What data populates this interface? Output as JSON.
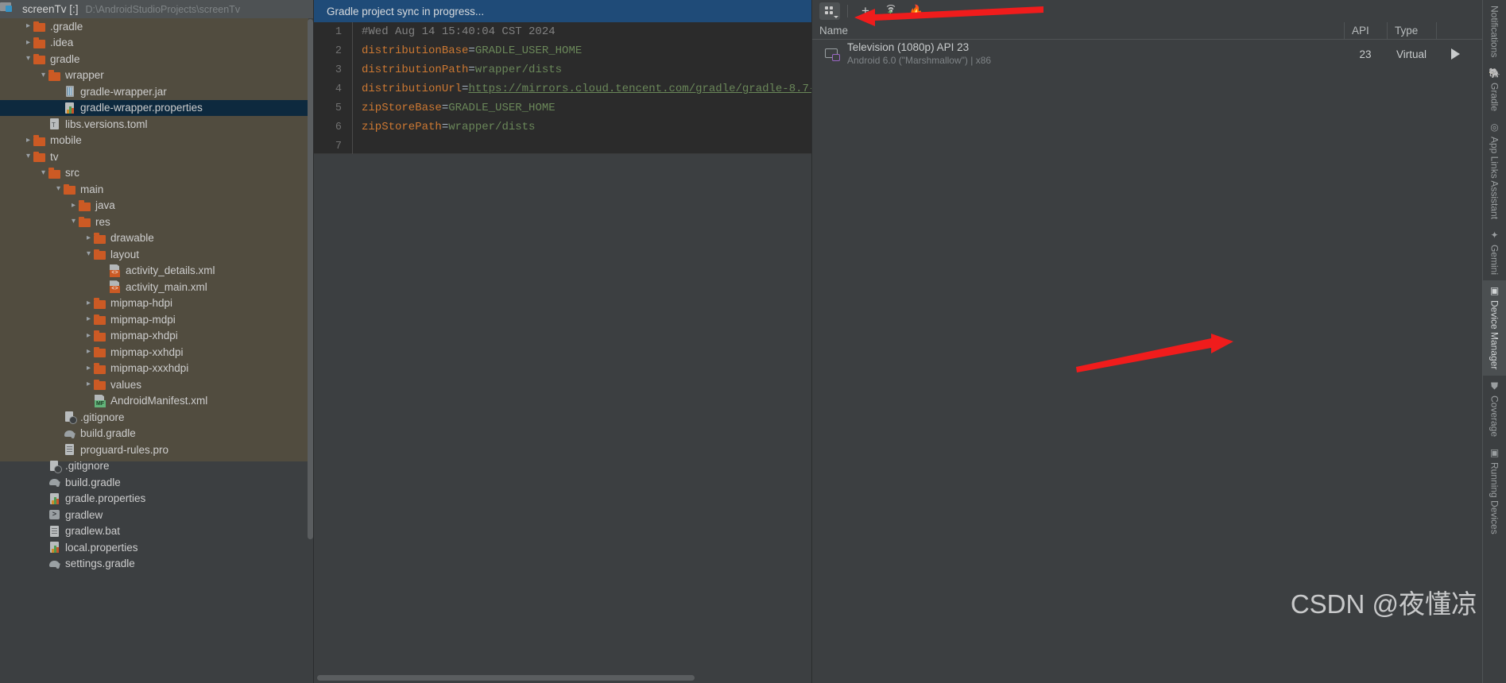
{
  "project": {
    "root_label": "screenTv [:]",
    "root_path": "D:\\AndroidStudioProjects\\screenTv",
    "tree": [
      {
        "label": ".gradle",
        "depth": 1,
        "chev": "right",
        "icon": "folder",
        "selected": false,
        "band": true
      },
      {
        "label": ".idea",
        "depth": 1,
        "chev": "right",
        "icon": "folder",
        "selected": false,
        "band": true
      },
      {
        "label": "gradle",
        "depth": 1,
        "chev": "down",
        "icon": "folder",
        "selected": false,
        "band": true
      },
      {
        "label": "wrapper",
        "depth": 2,
        "chev": "down",
        "icon": "folder",
        "selected": false,
        "band": true
      },
      {
        "label": "gradle-wrapper.jar",
        "depth": 3,
        "chev": "none",
        "icon": "jar",
        "selected": false,
        "band": true
      },
      {
        "label": "gradle-wrapper.properties",
        "depth": 3,
        "chev": "none",
        "icon": "props",
        "selected": true,
        "band": true
      },
      {
        "label": "libs.versions.toml",
        "depth": 2,
        "chev": "none",
        "icon": "toml",
        "selected": false,
        "band": true
      },
      {
        "label": "mobile",
        "depth": 1,
        "chev": "right",
        "icon": "folder",
        "selected": false,
        "band": true
      },
      {
        "label": "tv",
        "depth": 1,
        "chev": "down",
        "icon": "folder",
        "selected": false,
        "band": true
      },
      {
        "label": "src",
        "depth": 2,
        "chev": "down",
        "icon": "folder",
        "selected": false,
        "band": true
      },
      {
        "label": "main",
        "depth": 3,
        "chev": "down",
        "icon": "folder",
        "selected": false,
        "band": true
      },
      {
        "label": "java",
        "depth": 4,
        "chev": "right",
        "icon": "folder",
        "selected": false,
        "band": true
      },
      {
        "label": "res",
        "depth": 4,
        "chev": "down",
        "icon": "folder",
        "selected": false,
        "band": true
      },
      {
        "label": "drawable",
        "depth": 5,
        "chev": "right",
        "icon": "folder",
        "selected": false,
        "band": true
      },
      {
        "label": "layout",
        "depth": 5,
        "chev": "down",
        "icon": "folder",
        "selected": false,
        "band": true
      },
      {
        "label": "activity_details.xml",
        "depth": 6,
        "chev": "none",
        "icon": "xml",
        "selected": false,
        "band": true
      },
      {
        "label": "activity_main.xml",
        "depth": 6,
        "chev": "none",
        "icon": "xml",
        "selected": false,
        "band": true
      },
      {
        "label": "mipmap-hdpi",
        "depth": 5,
        "chev": "right",
        "icon": "folder",
        "selected": false,
        "band": true
      },
      {
        "label": "mipmap-mdpi",
        "depth": 5,
        "chev": "right",
        "icon": "folder",
        "selected": false,
        "band": true
      },
      {
        "label": "mipmap-xhdpi",
        "depth": 5,
        "chev": "right",
        "icon": "folder",
        "selected": false,
        "band": true
      },
      {
        "label": "mipmap-xxhdpi",
        "depth": 5,
        "chev": "right",
        "icon": "folder",
        "selected": false,
        "band": true
      },
      {
        "label": "mipmap-xxxhdpi",
        "depth": 5,
        "chev": "right",
        "icon": "folder",
        "selected": false,
        "band": true
      },
      {
        "label": "values",
        "depth": 5,
        "chev": "right",
        "icon": "folder",
        "selected": false,
        "band": true
      },
      {
        "label": "AndroidManifest.xml",
        "depth": 5,
        "chev": "none",
        "icon": "mf",
        "selected": false,
        "band": true
      },
      {
        "label": ".gitignore",
        "depth": 3,
        "chev": "none",
        "icon": "git",
        "selected": false,
        "band": true
      },
      {
        "label": "build.gradle",
        "depth": 3,
        "chev": "none",
        "icon": "elephant",
        "selected": false,
        "band": true
      },
      {
        "label": "proguard-rules.pro",
        "depth": 3,
        "chev": "none",
        "icon": "file",
        "selected": false,
        "band": true
      },
      {
        "label": ".gitignore",
        "depth": 2,
        "chev": "none",
        "icon": "git",
        "selected": false,
        "band": false
      },
      {
        "label": "build.gradle",
        "depth": 2,
        "chev": "none",
        "icon": "elephant",
        "selected": false,
        "band": false
      },
      {
        "label": "gradle.properties",
        "depth": 2,
        "chev": "none",
        "icon": "props",
        "selected": false,
        "band": false
      },
      {
        "label": "gradlew",
        "depth": 2,
        "chev": "none",
        "icon": "sh",
        "selected": false,
        "band": false
      },
      {
        "label": "gradlew.bat",
        "depth": 2,
        "chev": "none",
        "icon": "file",
        "selected": false,
        "band": false
      },
      {
        "label": "local.properties",
        "depth": 2,
        "chev": "none",
        "icon": "props",
        "selected": false,
        "band": false
      },
      {
        "label": "settings.gradle",
        "depth": 2,
        "chev": "none",
        "icon": "elephant",
        "selected": false,
        "band": false
      }
    ]
  },
  "editor": {
    "sync_banner": "Gradle project sync in progress...",
    "lines": [
      {
        "num": "1",
        "kind": "comment",
        "text": "#Wed Aug 14 15:40:04 CST 2024"
      },
      {
        "num": "2",
        "kind": "kv",
        "key": "distributionBase",
        "value": "GRADLE_USER_HOME"
      },
      {
        "num": "3",
        "kind": "kv",
        "key": "distributionPath",
        "value": "wrapper/dists"
      },
      {
        "num": "4",
        "kind": "url",
        "key": "distributionUrl",
        "value": "https://mirrors.cloud.tencent.com/gradle/gradle-8.7-"
      },
      {
        "num": "5",
        "kind": "kv",
        "key": "zipStoreBase",
        "value": "GRADLE_USER_HOME"
      },
      {
        "num": "6",
        "kind": "kv",
        "key": "zipStorePath",
        "value": "wrapper/dists"
      },
      {
        "num": "7",
        "kind": "empty",
        "text": ""
      }
    ],
    "status_check": "✔"
  },
  "device_manager": {
    "toolbar": {
      "layout_button": "device-layout",
      "add_device": "+",
      "pair_wifi": "pair-over-wifi",
      "firebase": "🔥"
    },
    "columns": [
      "Name",
      "API",
      "Type",
      ""
    ],
    "devices": [
      {
        "name": "Television (1080p) API 23",
        "detail": "Android 6.0 (\"Marshmallow\") | x86",
        "api": "23",
        "type": "Virtual",
        "run_action": "run",
        "more_action": "more"
      }
    ]
  },
  "tool_strip": [
    {
      "label": "Notifications",
      "icon": "",
      "active": false
    },
    {
      "label": "Gradle",
      "icon": "gradle-elephant-icon",
      "active": false
    },
    {
      "label": "App Links Assistant",
      "icon": "link-icon",
      "active": false
    },
    {
      "label": "Gemini",
      "icon": "sparkle-icon",
      "active": false
    },
    {
      "label": "Device Manager",
      "icon": "device-icon",
      "active": true
    },
    {
      "label": "Coverage",
      "icon": "shield-icon",
      "active": false
    },
    {
      "label": "Running Devices",
      "icon": "running-device-icon",
      "active": false
    }
  ],
  "watermark": "CSDN @夜懂凉",
  "colors": {
    "accent_blue": "#1f4b78",
    "selection": "#0d293e",
    "module_band": "#514c3f",
    "folder_orange": "#cc5a24",
    "annotation_red": "#f01c1c"
  }
}
